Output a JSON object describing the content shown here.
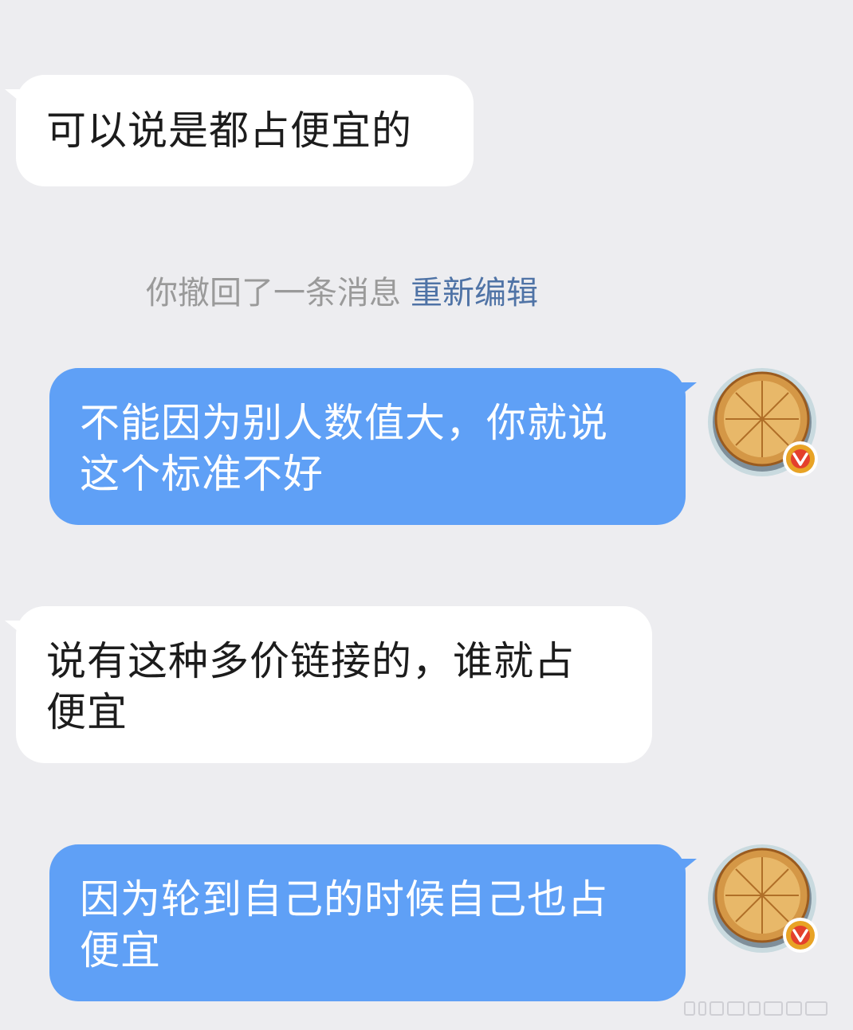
{
  "chat": {
    "messages": [
      {
        "side": "in",
        "lines": [
          "可以说是都占便宜的"
        ]
      },
      {
        "side": "out",
        "lines": [
          "不能因为别人数值大，你就说",
          "这个标准不好"
        ]
      },
      {
        "side": "in",
        "lines": [
          "说有这种多价链接的，谁就占",
          "便宜"
        ]
      },
      {
        "side": "out",
        "lines": [
          "因为轮到自己的时候自己也占",
          "便宜"
        ]
      }
    ],
    "system_notice": {
      "text": "你撤回了一条消息",
      "action": "重新编辑"
    },
    "avatar": {
      "icon": "pie-avatar-icon",
      "badge_icon": "verified-v-badge-icon",
      "badge_color": "#e8a325"
    }
  },
  "colors": {
    "background": "#ededf0",
    "incoming_bubble": "#ffffff",
    "outgoing_bubble": "#5fa0f6",
    "recall_text": "#9a9a9a",
    "recall_link": "#4f73a6"
  }
}
